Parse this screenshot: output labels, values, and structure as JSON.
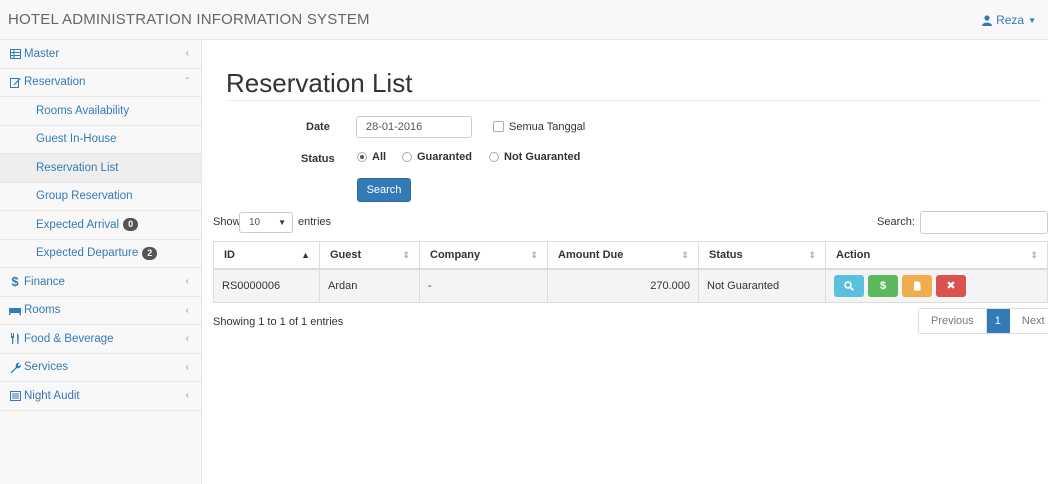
{
  "app": {
    "title": "HOTEL ADMINISTRATION INFORMATION SYSTEM",
    "user": "Reza"
  },
  "sidebar": {
    "items": [
      {
        "label": "Master",
        "icon": "table-icon"
      },
      {
        "label": "Reservation",
        "icon": "edit-icon"
      },
      {
        "label": "Rooms Availability"
      },
      {
        "label": "Guest In-House"
      },
      {
        "label": "Reservation List"
      },
      {
        "label": "Group Reservation"
      },
      {
        "label": "Expected Arrival",
        "badge": "0"
      },
      {
        "label": "Expected Departure",
        "badge": "2"
      },
      {
        "label": "Finance",
        "icon": "dollar-icon"
      },
      {
        "label": "Rooms",
        "icon": "bed-icon"
      },
      {
        "label": "Food & Beverage",
        "icon": "cutlery-icon"
      },
      {
        "label": "Services",
        "icon": "wrench-icon"
      },
      {
        "label": "Night Audit",
        "icon": "list-icon"
      }
    ]
  },
  "page": {
    "title": "Reservation List"
  },
  "filter": {
    "date_label": "Date",
    "date_value": "28-01-2016",
    "all_dates_label": "Semua Tanggal",
    "status_label": "Status",
    "status_options": [
      "All",
      "Guaranted",
      "Not Guaranted"
    ],
    "search_button": "Search"
  },
  "table_controls": {
    "show": "Show",
    "length": "10",
    "entries": "entries",
    "search": "Search:"
  },
  "table": {
    "headers": [
      "ID",
      "Guest",
      "Company",
      "Amount Due",
      "Status",
      "Action"
    ],
    "rows": [
      {
        "id": "RS0000006",
        "guest": "Ardan",
        "company": "-",
        "amount": "270.000",
        "status": "Not Guaranted"
      }
    ]
  },
  "footer": {
    "info": "Showing 1 to 1 of 1 entries",
    "prev": "Previous",
    "page": "1",
    "next": "Next"
  },
  "colors": {
    "primary": "#337ab7",
    "info": "#5bc0de",
    "success": "#5cb85c",
    "warning": "#f0ad4e",
    "danger": "#d9534f"
  }
}
